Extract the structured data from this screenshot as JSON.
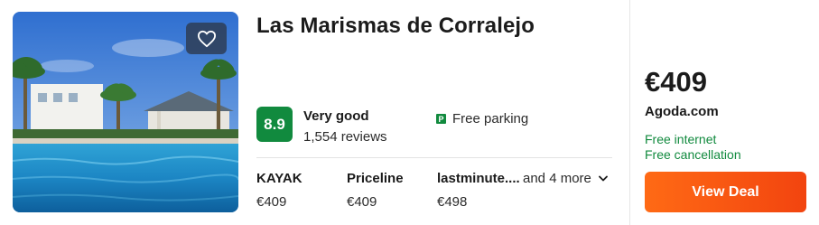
{
  "hotel": {
    "name": "Las Marismas de Corralejo",
    "score": "8.9",
    "rating_label": "Very good",
    "reviews": "1,554 reviews",
    "amenity": {
      "icon": "parking-icon",
      "glyph": "P",
      "label": "Free parking"
    }
  },
  "providers": [
    {
      "name": "KAYAK",
      "price": "€409"
    },
    {
      "name": "Priceline",
      "price": "€409"
    },
    {
      "name": "lastminute....",
      "price": "€498"
    }
  ],
  "more_label": "and 4 more",
  "deal": {
    "price": "€409",
    "site": "Agoda.com",
    "perks": [
      "Free internet",
      "Free cancellation"
    ],
    "button_label": "View Deal"
  },
  "colors": {
    "score_bg": "#118a3e",
    "perk_text": "#118a3e",
    "button_start": "#ff6a15",
    "button_end": "#f2440f"
  },
  "icons": {
    "favorite": "heart-icon",
    "expand": "chevron-down-icon"
  }
}
